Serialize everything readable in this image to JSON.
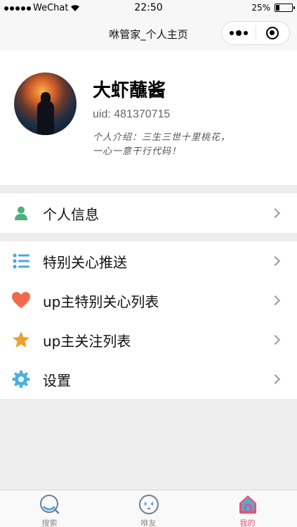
{
  "status_bar": {
    "carrier": "WeChat",
    "time": "22:50",
    "battery": "25%",
    "battery_level": 0.25
  },
  "nav": {
    "title": "咻管家_个人主页"
  },
  "profile": {
    "username": "大虾蘸酱",
    "uid": "uid: 481370715",
    "intro_line1": "个人介绍：三生三世十里桃花，",
    "intro_line2": "一心一意干行代码！"
  },
  "menu": {
    "personal_info": "个人信息",
    "items": [
      {
        "label": "特别关心推送",
        "icon": "list-icon"
      },
      {
        "label": "up主特别关心列表",
        "icon": "heart-icon"
      },
      {
        "label": "up主关注列表",
        "icon": "star-icon"
      },
      {
        "label": "设置",
        "icon": "gear-icon"
      }
    ]
  },
  "tabs": [
    {
      "label": "搜索",
      "icon": "search-icon"
    },
    {
      "label": "咻友",
      "icon": "friend-icon"
    },
    {
      "label": "我的",
      "icon": "home-icon",
      "active": true
    }
  ],
  "colors": {
    "accent": "#e8546f",
    "user_green": "#4caf7d",
    "list_blue": "#4aa8dc",
    "heart_red": "#f06a4c",
    "star_orange": "#f0a030",
    "gear_blue": "#4ab0e0"
  }
}
